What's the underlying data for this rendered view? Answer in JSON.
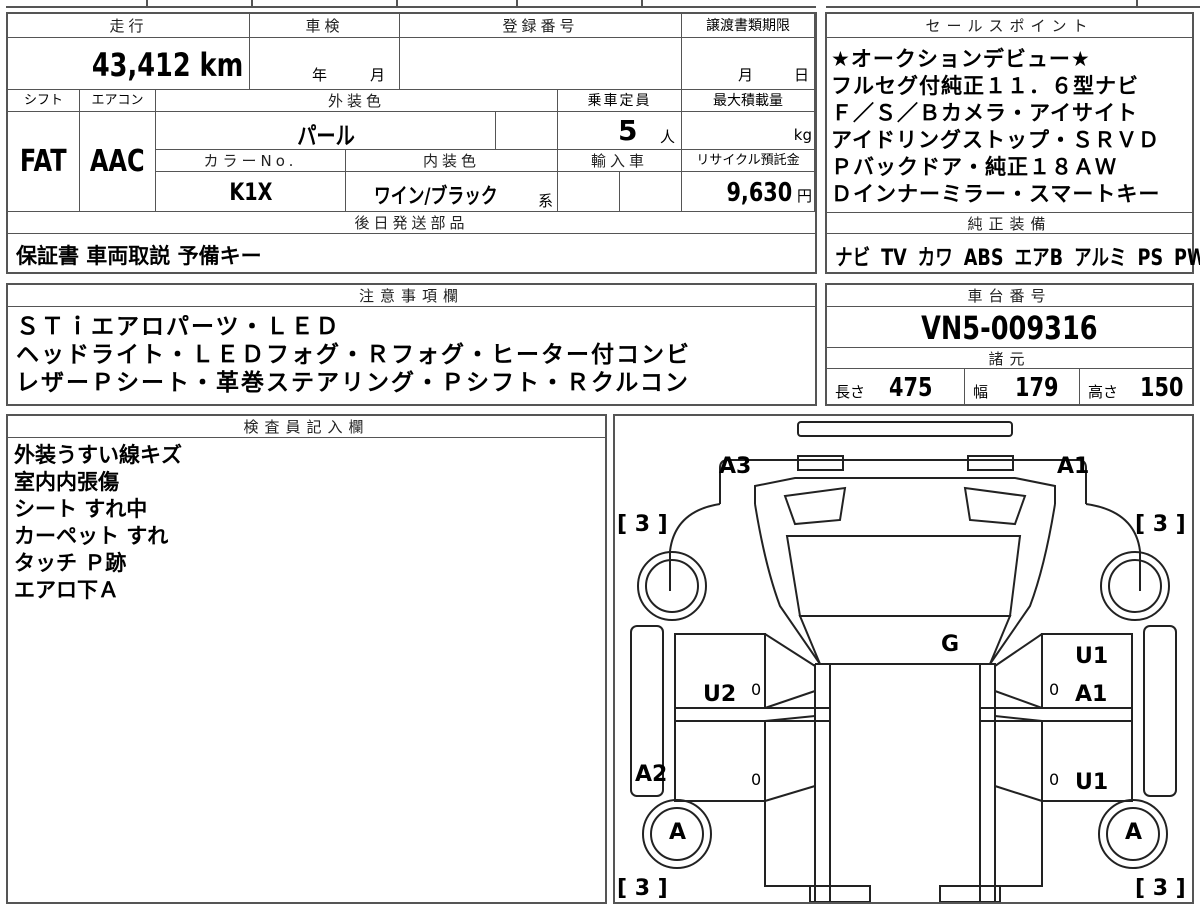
{
  "mileage": {
    "label": "走行",
    "value": "43,412",
    "unit": "km"
  },
  "inspection": {
    "label": "車検",
    "year_unit": "年",
    "month_unit": "月"
  },
  "registration": {
    "label": "登録番号",
    "value": ""
  },
  "transfer_deadline": {
    "label": "譲渡書類期限",
    "month_unit": "月",
    "day_unit": "日"
  },
  "shift": {
    "label": "シフト",
    "value": "FAT"
  },
  "aircon": {
    "label": "エアコン",
    "value": "AAC"
  },
  "exterior_color": {
    "label": "外装色",
    "value": "パール"
  },
  "capacity": {
    "label": "乗車定員",
    "value": "5",
    "unit": "人"
  },
  "max_load": {
    "label": "最大積載量",
    "unit": "kg"
  },
  "color_no": {
    "label": "カラーNo.",
    "value": "K1X"
  },
  "interior_color": {
    "label": "内装色",
    "value": "ワイン/ブラック",
    "suffix": "系"
  },
  "import": {
    "label": "輸入車"
  },
  "recycle": {
    "label": "リサイクル預託金",
    "value": "9,630",
    "unit": "円"
  },
  "later_parts": {
    "label": "後日発送部品",
    "value": "保証書 車両取説 予備キー"
  },
  "sales_points": {
    "label": "セールスポイント",
    "lines": [
      "★オークションデビュー★",
      "フルセグ付純正１１．６型ナビ",
      "Ｆ／Ｓ／Ｂカメラ・アイサイト",
      "アイドリングストップ・ＳＲＶＤ",
      "Ｐバックドア・純正１８ＡＷ",
      "Ｄインナーミラー・スマートキー"
    ]
  },
  "standard_equipment": {
    "label": "純正装備",
    "value": "ナビ TV カワ ABS エアB アルミ PS PW"
  },
  "notes": {
    "label": "注意事項欄",
    "lines": [
      "ＳＴｉエアロパーツ・ＬＥＤ",
      "ヘッドライト・ＬＥＤフォグ・Ｒフォグ・ヒーター付コンビ",
      "レザーＰシート・革巻ステアリング・Ｐシフト・Ｒクルコン"
    ]
  },
  "chassis": {
    "label": "車台番号",
    "value": "VN5-009316"
  },
  "specs": {
    "label": "諸元",
    "length_label": "長さ",
    "length": "475",
    "width_label": "幅",
    "width": "179",
    "height_label": "高さ",
    "height": "150"
  },
  "inspector": {
    "label": "検査員記入欄",
    "lines": [
      "外装うすい線キズ",
      "室内内張傷",
      "シート すれ中",
      "カーペット すれ",
      "タッチ Ｐ跡",
      "エアロ下Ａ"
    ]
  },
  "damage_map": {
    "marks": {
      "front_left": "A3",
      "front_right": "A1",
      "glass": "G",
      "left_front_door": "U2",
      "right_front_door_top": "U1",
      "right_front_door": "A1",
      "left_rear": "A2",
      "right_rear_door": "U1",
      "rear_left_wheel": "A",
      "rear_right_wheel": "A",
      "tire_fl": "[ 3 ]",
      "tire_fr": "[ 3 ]",
      "tire_rl": "[ 3 ]",
      "tire_rr": "[ 3 ]",
      "zero": "0"
    }
  }
}
